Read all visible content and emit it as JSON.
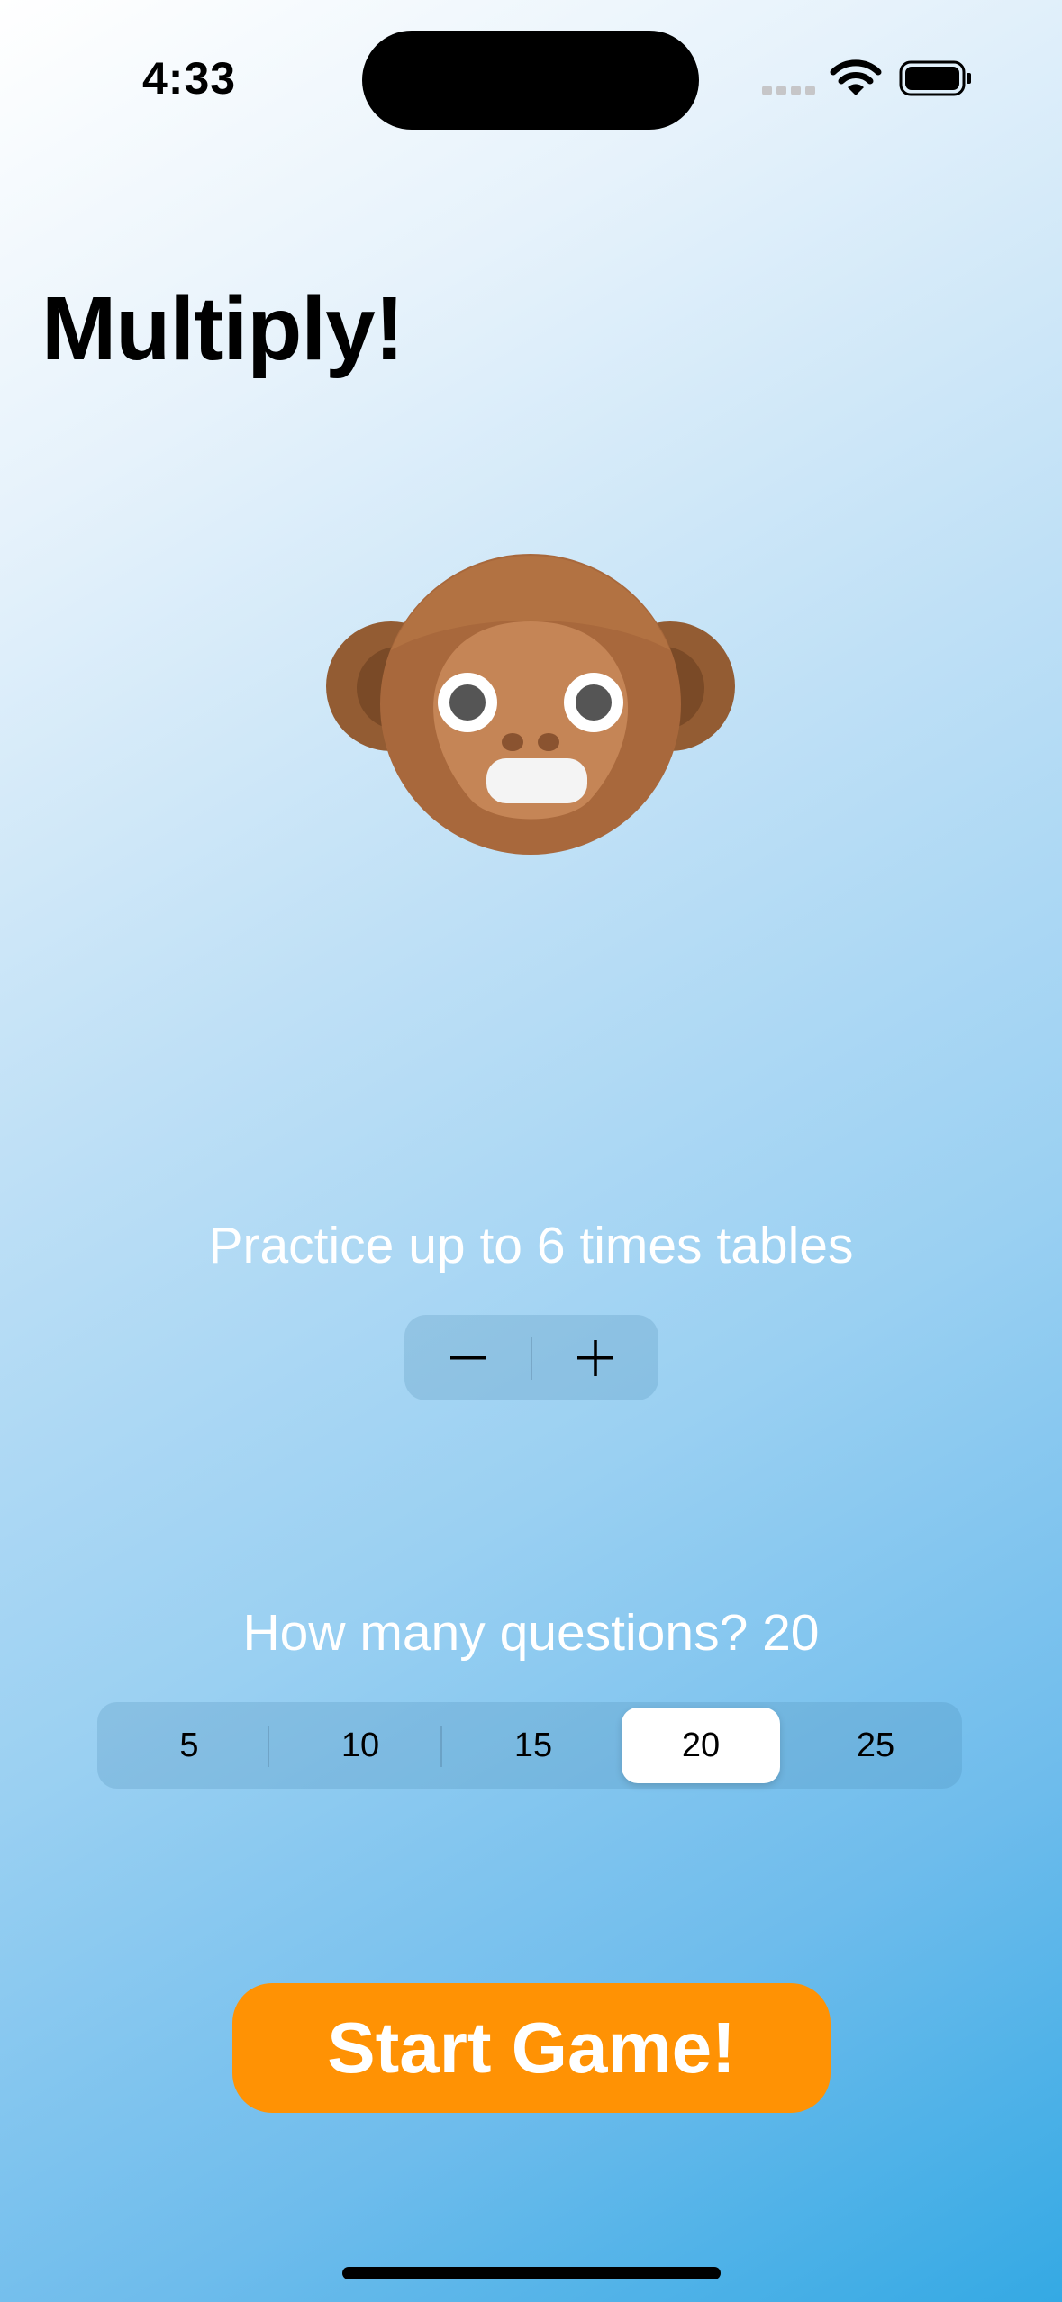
{
  "status_bar": {
    "time": "4:33",
    "icons": [
      "cellular-signal-icon",
      "wifi-icon",
      "battery-icon"
    ]
  },
  "title": "Multiply!",
  "mascot": {
    "icon": "monkey-face-icon"
  },
  "practice": {
    "label": "Practice up to 6 times tables",
    "max_table": 6,
    "decrement_symbol": "−",
    "increment_symbol": "+"
  },
  "questions": {
    "label": "How many questions? 20",
    "options": [
      "5",
      "10",
      "15",
      "20",
      "25"
    ],
    "selected": "20"
  },
  "start_button": {
    "label": "Start Game!"
  },
  "colors": {
    "accent": "#ff9204",
    "background_top": "#ffffff",
    "background_bottom": "#34a9e4",
    "label_text": "#ffffff"
  }
}
